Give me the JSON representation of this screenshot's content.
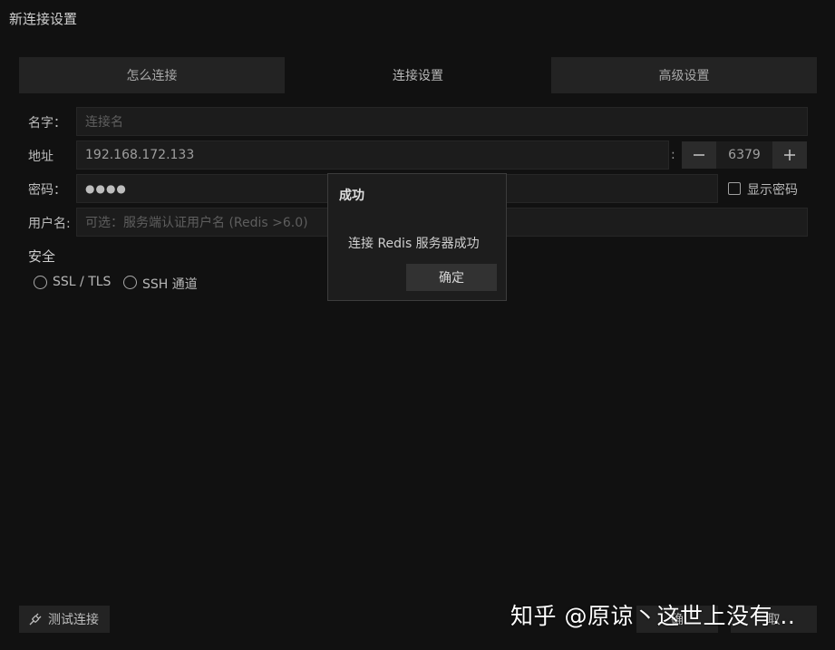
{
  "window": {
    "title": "新连接设置"
  },
  "tabs": [
    {
      "label": "怎么连接"
    },
    {
      "label": "连接设置"
    },
    {
      "label": "高级设置"
    }
  ],
  "form": {
    "name_label": "名字：",
    "name_placeholder": "连接名",
    "address_label": "地址",
    "address_value": "192.168.172.133",
    "port_separator": ":",
    "port_value": "6379",
    "password_label": "密码：",
    "password_value": "●●●●",
    "show_password_label": "显示密码",
    "username_label": "用户名:",
    "username_placeholder": "可选：服务端认证用户名 (Redis >6.0)"
  },
  "security": {
    "title": "安全",
    "options": [
      {
        "label": "SSL / TLS"
      },
      {
        "label": "SSH 通道"
      }
    ]
  },
  "footer": {
    "test_label": "测试连接",
    "ok_label": "确",
    "cancel_label": "取"
  },
  "dialog": {
    "title": "成功",
    "message": "连接 Redis 服务器成功",
    "ok_label": "确定"
  },
  "watermark": {
    "text": "知乎 @原谅丶这世上没有..."
  },
  "colors": {
    "background": "#111111",
    "panel": "#232323",
    "input": "#1c1c1c",
    "dialog": "#1d1d1d"
  }
}
